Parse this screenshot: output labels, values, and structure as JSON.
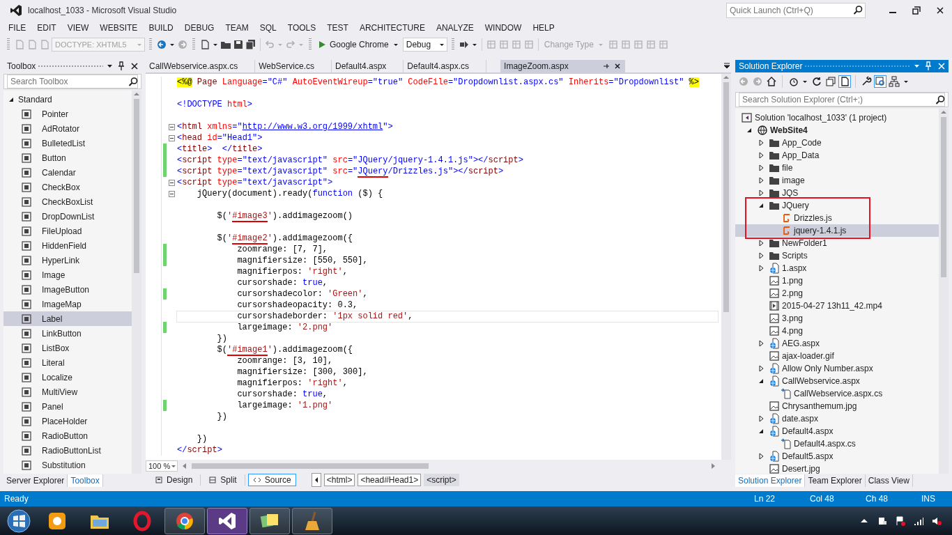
{
  "window": {
    "title": "localhost_1033 - Microsoft Visual Studio",
    "quick_launch": {
      "placeholder": "Quick Launch (Ctrl+Q)"
    }
  },
  "menu": [
    "FILE",
    "EDIT",
    "VIEW",
    "WEBSITE",
    "BUILD",
    "DEBUG",
    "TEAM",
    "SQL",
    "TOOLS",
    "TEST",
    "ARCHITECTURE",
    "ANALYZE",
    "WINDOW",
    "HELP"
  ],
  "toolbar": [
    {
      "kind": "combo",
      "value": "DOCTYPE: XHTML5",
      "disabled": true
    },
    {
      "kind": "run",
      "label": "Google Chrome",
      "disabled": false
    },
    {
      "kind": "combo",
      "value": "Debug",
      "disabled": false
    },
    {
      "kind": "menu",
      "label": "Change Type",
      "disabled": true
    }
  ],
  "toolbox": {
    "title": "Toolbox",
    "search": {
      "placeholder": "Search Toolbox"
    },
    "groups": [
      {
        "label": "Standard",
        "expanded": true,
        "items": [
          {
            "label": "Pointer",
            "selected": false
          },
          {
            "label": "AdRotator",
            "selected": false
          },
          {
            "label": "BulletedList",
            "selected": false
          },
          {
            "label": "Button",
            "selected": false
          },
          {
            "label": "Calendar",
            "selected": false
          },
          {
            "label": "CheckBox",
            "selected": false
          },
          {
            "label": "CheckBoxList",
            "selected": false
          },
          {
            "label": "DropDownList",
            "selected": false
          },
          {
            "label": "FileUpload",
            "selected": false
          },
          {
            "label": "HiddenField",
            "selected": false
          },
          {
            "label": "HyperLink",
            "selected": false
          },
          {
            "label": "Image",
            "selected": false
          },
          {
            "label": "ImageButton",
            "selected": false
          },
          {
            "label": "ImageMap",
            "selected": false
          },
          {
            "label": "Label",
            "selected": true
          },
          {
            "label": "LinkButton",
            "selected": false
          },
          {
            "label": "ListBox",
            "selected": false
          },
          {
            "label": "Literal",
            "selected": false
          },
          {
            "label": "Localize",
            "selected": false
          },
          {
            "label": "MultiView",
            "selected": false
          },
          {
            "label": "Panel",
            "selected": false
          },
          {
            "label": "PlaceHolder",
            "selected": false
          },
          {
            "label": "RadioButton",
            "selected": false
          },
          {
            "label": "RadioButtonList",
            "selected": false
          },
          {
            "label": "Substitution",
            "selected": false
          }
        ]
      }
    ],
    "tabs": [
      {
        "label": "Server Explorer",
        "selected": false
      },
      {
        "label": "Toolbox",
        "selected": true
      }
    ]
  },
  "editor": {
    "tabs": [
      {
        "label": "CallWebservice.aspx.cs",
        "selected": false
      },
      {
        "label": "WebService.cs",
        "selected": false
      },
      {
        "label": "Default4.aspx",
        "selected": false
      },
      {
        "label": "Default4.aspx.cs",
        "selected": false
      },
      {
        "label": "ImageZoom.aspx",
        "selected": true
      }
    ],
    "lines": [
      {
        "changed": false,
        "tokens": [
          {
            "kind": "directive",
            "text": "<%@"
          },
          {
            "kind": "element",
            "text": " Page"
          },
          {
            "kind": "attr",
            "text": " Language"
          },
          {
            "kind": "value",
            "text": "=\"C#\""
          },
          {
            "kind": "attr",
            "text": " AutoEventWireup"
          },
          {
            "kind": "value",
            "text": "=\"true\""
          },
          {
            "kind": "attr",
            "text": " CodeFile"
          },
          {
            "kind": "value",
            "text": "=\"Dropdownlist.aspx.cs\""
          },
          {
            "kind": "attr",
            "text": " Inherits"
          },
          {
            "kind": "value",
            "text": "=\"Dropdownlist\" "
          },
          {
            "kind": "directive",
            "text": "%>"
          }
        ]
      },
      {
        "changed": false
      },
      {
        "changed": false,
        "tokens": [
          {
            "kind": "punct",
            "text": "<!DOCTYPE"
          },
          {
            "kind": "attr",
            "text": " html"
          },
          {
            "kind": "punct",
            "text": ">"
          }
        ]
      },
      {
        "changed": false
      },
      {
        "changed": false,
        "fold": true,
        "tokens": [
          {
            "kind": "punct",
            "text": "<"
          },
          {
            "kind": "element",
            "text": "html"
          },
          {
            "kind": "attr",
            "text": " xmlns"
          },
          {
            "kind": "value",
            "text": "=\""
          },
          {
            "kind": "link",
            "text": "http://www.w3.org/1999/xhtml"
          },
          {
            "kind": "value",
            "text": "\""
          },
          {
            "kind": "punct",
            "text": ">"
          }
        ]
      },
      {
        "changed": false,
        "fold": true,
        "tokens": [
          {
            "kind": "punct",
            "text": "<"
          },
          {
            "kind": "element",
            "text": "head"
          },
          {
            "kind": "attr",
            "text": " id"
          },
          {
            "kind": "value",
            "text": "=\"Head1\""
          },
          {
            "kind": "punct",
            "text": ">"
          }
        ]
      },
      {
        "changed": true,
        "tokens": [
          {
            "kind": "punct",
            "text": "<"
          },
          {
            "kind": "element",
            "text": "title"
          },
          {
            "kind": "punct",
            "text": ">  </"
          },
          {
            "kind": "element",
            "text": "title"
          },
          {
            "kind": "punct",
            "text": ">"
          }
        ]
      },
      {
        "changed": true,
        "tokens": [
          {
            "kind": "punct",
            "text": "<"
          },
          {
            "kind": "element",
            "text": "script"
          },
          {
            "kind": "attr",
            "text": " type"
          },
          {
            "kind": "value",
            "text": "=\"text/javascript\""
          },
          {
            "kind": "attr",
            "text": " src"
          },
          {
            "kind": "value",
            "text": "=\"JQuery/jquery-1.4.1.js\""
          },
          {
            "kind": "punct",
            "text": "></"
          },
          {
            "kind": "element",
            "text": "script"
          },
          {
            "kind": "punct",
            "text": ">"
          }
        ]
      },
      {
        "changed": true,
        "tokens": [
          {
            "kind": "punct",
            "text": "<"
          },
          {
            "kind": "element",
            "text": "script"
          },
          {
            "kind": "attr",
            "text": " type"
          },
          {
            "kind": "value",
            "text": "=\"text/javascript\""
          },
          {
            "kind": "attr",
            "text": " src"
          },
          {
            "kind": "value",
            "text": "=\""
          },
          {
            "kind": "value",
            "text": "JQuery",
            "marked": true
          },
          {
            "kind": "value",
            "text": "/Drizzles.js\""
          },
          {
            "kind": "punct",
            "text": "></"
          },
          {
            "kind": "element",
            "text": "script"
          },
          {
            "kind": "punct",
            "text": ">"
          }
        ]
      },
      {
        "changed": false,
        "fold": true,
        "tokens": [
          {
            "kind": "punct",
            "text": "<"
          },
          {
            "kind": "element",
            "text": "script"
          },
          {
            "kind": "attr",
            "text": " type"
          },
          {
            "kind": "value",
            "text": "=\"text/javascript\""
          },
          {
            "kind": "punct",
            "text": ">"
          }
        ]
      },
      {
        "changed": false,
        "fold": true,
        "tokens": [
          {
            "kind": "text",
            "text": "    jQuery(document).ready("
          },
          {
            "kind": "keyword",
            "text": "function"
          },
          {
            "kind": "text",
            "text": " ($) {"
          }
        ]
      },
      {
        "changed": false
      },
      {
        "changed": false,
        "tokens": [
          {
            "kind": "text",
            "text": "        $("
          },
          {
            "kind": "string",
            "text": "'"
          },
          {
            "kind": "string",
            "text": "#image3",
            "marked": true
          },
          {
            "kind": "string",
            "text": "'"
          },
          {
            "kind": "text",
            "text": ").addimagezoom()"
          }
        ]
      },
      {
        "changed": false
      },
      {
        "changed": false,
        "tokens": [
          {
            "kind": "text",
            "text": "        $("
          },
          {
            "kind": "string",
            "text": "'"
          },
          {
            "kind": "string",
            "text": "#image2",
            "marked": true
          },
          {
            "kind": "string",
            "text": "'"
          },
          {
            "kind": "text",
            "text": ").addimagezoom({"
          }
        ]
      },
      {
        "changed": true,
        "tokens": [
          {
            "kind": "text",
            "text": "            zoomrange: [7, 7],"
          }
        ]
      },
      {
        "changed": true,
        "tokens": [
          {
            "kind": "text",
            "text": "            magnifiersize: [550, 550],"
          }
        ]
      },
      {
        "changed": false,
        "tokens": [
          {
            "kind": "text",
            "text": "            magnifierpos: "
          },
          {
            "kind": "string",
            "text": "'right'"
          },
          {
            "kind": "text",
            "text": ","
          }
        ]
      },
      {
        "changed": false,
        "tokens": [
          {
            "kind": "text",
            "text": "            cursorshade: "
          },
          {
            "kind": "keyword",
            "text": "true"
          },
          {
            "kind": "text",
            "text": ","
          }
        ]
      },
      {
        "changed": true,
        "tokens": [
          {
            "kind": "text",
            "text": "            cursorshadecolor: "
          },
          {
            "kind": "string",
            "text": "'Green'"
          },
          {
            "kind": "text",
            "text": ","
          }
        ]
      },
      {
        "changed": false,
        "tokens": [
          {
            "kind": "text",
            "text": "            cursorshadeopacity: 0.3,"
          }
        ]
      },
      {
        "changed": false,
        "current": true,
        "tokens": [
          {
            "kind": "text",
            "text": "            cursorshadeborder: "
          },
          {
            "kind": "string",
            "text": "'1px solid red'"
          },
          {
            "kind": "text",
            "text": ","
          }
        ]
      },
      {
        "changed": true,
        "tokens": [
          {
            "kind": "text",
            "text": "            largeimage: "
          },
          {
            "kind": "string",
            "text": "'2.png'"
          }
        ]
      },
      {
        "changed": false,
        "tokens": [
          {
            "kind": "text",
            "text": "        })"
          }
        ]
      },
      {
        "changed": false,
        "tokens": [
          {
            "kind": "text",
            "text": "        $("
          },
          {
            "kind": "string",
            "text": "'#image1",
            "marked": true
          },
          {
            "kind": "string",
            "text": "'"
          },
          {
            "kind": "text",
            "text": ").addimagezoom({"
          }
        ]
      },
      {
        "changed": false,
        "tokens": [
          {
            "kind": "text",
            "text": "            zoomrange: [3, 10],"
          }
        ]
      },
      {
        "changed": false,
        "tokens": [
          {
            "kind": "text",
            "text": "            magnifiersize: [300, 300],"
          }
        ]
      },
      {
        "changed": false,
        "tokens": [
          {
            "kind": "text",
            "text": "            magnifierpos: "
          },
          {
            "kind": "string",
            "text": "'right'"
          },
          {
            "kind": "text",
            "text": ","
          }
        ]
      },
      {
        "changed": false,
        "tokens": [
          {
            "kind": "text",
            "text": "            cursorshade: "
          },
          {
            "kind": "keyword",
            "text": "true"
          },
          {
            "kind": "text",
            "text": ","
          }
        ]
      },
      {
        "changed": true,
        "tokens": [
          {
            "kind": "text",
            "text": "            largeimage: "
          },
          {
            "kind": "string",
            "text": "'1.png'"
          }
        ]
      },
      {
        "changed": false,
        "tokens": [
          {
            "kind": "text",
            "text": "        })"
          }
        ]
      },
      {
        "changed": false
      },
      {
        "changed": false,
        "tokens": [
          {
            "kind": "text",
            "text": "    })"
          }
        ]
      },
      {
        "changed": false,
        "tokens": [
          {
            "kind": "punct",
            "text": "</"
          },
          {
            "kind": "element",
            "text": "script"
          },
          {
            "kind": "punct",
            "text": ">"
          }
        ]
      }
    ],
    "zoom": "100 %",
    "views": [
      {
        "label": "Design",
        "selected": false
      },
      {
        "label": "Split",
        "selected": false
      },
      {
        "label": "Source",
        "selected": true
      }
    ],
    "breadcrumbs": [
      {
        "label": "<html>",
        "selected": false
      },
      {
        "label": "<head#Head1>",
        "selected": false
      },
      {
        "label": "<script>",
        "selected": true
      }
    ]
  },
  "solution_explorer": {
    "title": "Solution Explorer",
    "search": {
      "placeholder": "Search Solution Explorer (Ctrl+;)"
    },
    "tree": [
      {
        "label": "Solution 'localhost_1033' (1 project)",
        "kind": "solution",
        "selected": false,
        "children": [
          {
            "label": "WebSite4",
            "kind": "website",
            "expanded": true,
            "selected": false,
            "children": [
              {
                "label": "App_Code",
                "kind": "folder",
                "expanded": false,
                "selected": false
              },
              {
                "label": "App_Data",
                "kind": "folder",
                "expanded": false,
                "selected": false
              },
              {
                "label": "file",
                "kind": "folder",
                "expanded": false,
                "selected": false
              },
              {
                "label": "image",
                "kind": "folder",
                "expanded": false,
                "selected": false
              },
              {
                "label": "JQS",
                "kind": "folder",
                "expanded": false,
                "selected": false
              },
              {
                "label": "JQuery",
                "kind": "folder",
                "expanded": true,
                "selected": false,
                "annotated": true,
                "children": [
                  {
                    "label": "Drizzles.js",
                    "kind": "script",
                    "selected": false
                  },
                  {
                    "label": "jquery-1.4.1.js",
                    "kind": "script",
                    "selected": true
                  }
                ]
              },
              {
                "label": "NewFolder1",
                "kind": "folder",
                "expanded": false,
                "selected": false
              },
              {
                "label": "Scripts",
                "kind": "folder",
                "expanded": false,
                "selected": false
              },
              {
                "label": "1.aspx",
                "kind": "page",
                "expanded": false,
                "selected": false
              },
              {
                "label": "1.png",
                "kind": "image",
                "selected": false
              },
              {
                "label": "2.png",
                "kind": "image",
                "selected": false
              },
              {
                "label": "2015-04-27 13h11_42.mp4",
                "kind": "video",
                "selected": false
              },
              {
                "label": "3.png",
                "kind": "image",
                "selected": false
              },
              {
                "label": "4.png",
                "kind": "image",
                "selected": false
              },
              {
                "label": "AEG.aspx",
                "kind": "page",
                "expanded": false,
                "selected": false
              },
              {
                "label": "ajax-loader.gif",
                "kind": "image",
                "selected": false
              },
              {
                "label": "Allow Only Number.aspx",
                "kind": "page",
                "expanded": false,
                "selected": false
              },
              {
                "label": "CallWebservice.aspx",
                "kind": "page",
                "expanded": true,
                "selected": false,
                "children": [
                  {
                    "label": "CallWebservice.aspx.cs",
                    "kind": "code",
                    "selected": false
                  }
                ]
              },
              {
                "label": "Chrysanthemum.jpg",
                "kind": "image",
                "selected": false
              },
              {
                "label": "date.aspx",
                "kind": "page",
                "expanded": false,
                "selected": false
              },
              {
                "label": "Default4.aspx",
                "kind": "page",
                "expanded": true,
                "selected": false,
                "children": [
                  {
                    "label": "Default4.aspx.cs",
                    "kind": "code",
                    "selected": false
                  }
                ]
              },
              {
                "label": "Default5.aspx",
                "kind": "page",
                "expanded": false,
                "selected": false
              },
              {
                "label": "Desert.jpg",
                "kind": "image",
                "selected": false
              }
            ]
          }
        ]
      }
    ],
    "tabs": [
      {
        "label": "Solution Explorer",
        "selected": true
      },
      {
        "label": "Team Explorer",
        "selected": false
      },
      {
        "label": "Class View",
        "selected": false
      }
    ]
  },
  "status_bar": {
    "message": "Ready",
    "line": "Ln 22",
    "column": "Col 48",
    "char": "Ch 48",
    "mode": "INS"
  },
  "taskbar": {
    "apps": [
      {
        "running": false,
        "selected": false
      },
      {
        "running": false,
        "selected": false
      },
      {
        "running": false,
        "selected": false
      },
      {
        "running": true,
        "selected": false
      },
      {
        "running": true,
        "selected": true
      },
      {
        "running": true,
        "selected": false
      },
      {
        "running": true,
        "selected": false
      }
    ]
  }
}
